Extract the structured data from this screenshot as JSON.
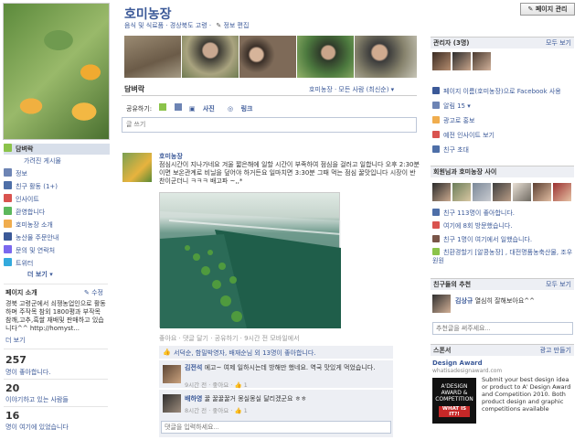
{
  "page": {
    "title": "호미농장",
    "category": "음식 및 식료품 · 경상북도 고령 ·",
    "edit_info": "정보 편집",
    "admin_button": "페이지 관리"
  },
  "nav": {
    "items": [
      {
        "label": "담벼락",
        "icon": "wall-icon",
        "color": "#8bc34a"
      },
      {
        "label": "가려진 게시물",
        "icon": "",
        "color": ""
      },
      {
        "label": "정보",
        "icon": "info-icon",
        "color": "#6d84b4"
      },
      {
        "label": "친구 활동 (1+)",
        "icon": "friends-icon",
        "color": "#4e6fa8"
      },
      {
        "label": "인사이트",
        "icon": "insights-icon",
        "color": "#d9534f"
      },
      {
        "label": "환영합니다",
        "icon": "welcome-icon",
        "color": "#5cb85c"
      },
      {
        "label": "호미농장 소개",
        "icon": "intro-icon",
        "color": "#f0ad4e"
      },
      {
        "label": "농산물 주문안내",
        "icon": "order-icon",
        "color": "#3b5998"
      },
      {
        "label": "문의 및 연락처",
        "icon": "contact-icon",
        "color": "#7b68ee"
      },
      {
        "label": "트위터",
        "icon": "twitter-icon",
        "color": "#33aadd"
      },
      {
        "label": "더 보기 ▾",
        "icon": "",
        "color": ""
      }
    ]
  },
  "about": {
    "heading": "페이지 소개",
    "edit": "✎ 수정",
    "text": "경북 고령군에서 쇠쟁농업인으로 활동하며 주작목 참외 1800평과 부작목 참깨,고추,흑쌀 재배및 판매하고 있습니다^^ http://homyst...",
    "more": "더 보기"
  },
  "stats": [
    {
      "num": "257",
      "label": "명이 좋아합니다."
    },
    {
      "num": "20",
      "label": "이야기하고 있는 사람들"
    },
    {
      "num": "16",
      "label": "명이 여기에 있었습니다"
    }
  ],
  "wall": {
    "tab": "담벼락",
    "filter": "호미농장 · 모든 사람 (최신순) ▾",
    "share_label": "공유하기:",
    "share_status": "",
    "share_photo": "사진",
    "share_link": "링크",
    "input_placeholder": "글 쓰기"
  },
  "post": {
    "author": "호미농장",
    "text": "점심시간이 지나가네요 겨울 짧은해에 일할 시간이 부족하여 점심을 걸러고 일합니다 오후 2:30분이면 보온관계로 비닐을 덮어야 하거든요 일마치면 3:30분 그때 먹는 점심 꿀맛입니다 시장이 반찬이군더니 ㅋㅋㅋ 배고파 ~,,*",
    "meta": "좋아요 · 댓글 달기 · 공유하기 · 9시간 전 모바일에서",
    "likes": "서덕순, 함밀박영자, 배재순님 외 13명이 좋아합니다."
  },
  "comments": [
    {
      "name": "김전석",
      "text": "에고~ 여제 일하시는데 방해만 했네요. 역국 맛있게 먹었습니다.",
      "meta": "9시간 전 · 좋아요 · 👍 1"
    },
    {
      "name": "배하영",
      "text": "꿀 꿀꿀꿀거 몽실몽실 달리겠군요 ㅎㅎ",
      "meta": "8시간 전 · 좋아요 · 👍 1"
    }
  ],
  "comment_placeholder": "댓글을 입력하세요...",
  "right": {
    "admins_heading": "관리자 (3명)",
    "admins_more": "모두 보기",
    "links": [
      {
        "label": "페이지 이름(호미농장)으로 Facebook 사용",
        "icon": "use-as-page-icon",
        "color": "#3b5998"
      },
      {
        "label": "알림 15 ▾",
        "icon": "notifications-icon",
        "color": "#6d84b4"
      },
      {
        "label": "광고로 홍보",
        "icon": "promote-icon",
        "color": "#f0ad4e"
      },
      {
        "label": "예전 인사이트 보기",
        "icon": "old-insights-icon",
        "color": "#d9534f"
      },
      {
        "label": "친구 초대",
        "icon": "invite-icon",
        "color": "#4e6fa8"
      }
    ],
    "mutual_heading": "회원님과 호미농장 사이",
    "mutual": [
      {
        "label": "친구 113명이 좋아합니다.",
        "icon": "likes-icon",
        "color": "#4e6fa8"
      },
      {
        "label": "여기에 8회 방문했습니다.",
        "icon": "checkin-icon",
        "color": "#d9534f"
      },
      {
        "label": "친구 1명이 여기에서 일했습니다.",
        "icon": "work-icon",
        "color": "#795548"
      },
      {
        "label": "친환경할기 [알콩농장] , 대전명품농축산물, 조우 원원",
        "icon": "similar-icon",
        "color": "#8bc34a"
      }
    ],
    "suggest_heading": "친구들의 추천",
    "suggest_more": "모두 보기",
    "suggest_name": "김상규",
    "suggest_text": "열심히 잘해보아요^^",
    "suggest_input": "추천글을 써주세요...",
    "sponsor_heading": "스폰서",
    "sponsor_more": "광고 만들기",
    "ad_title": "Design Award",
    "ad_domain": "whatisadesignaward.com",
    "ad_image_text": "A'DESIGN AWARD & COMPETITION",
    "ad_badge": "WHAT IS IT?!",
    "ad_text": "Submit your best design idea or product to A' Design Award and Competition 2010. Both product design and graphic competitions available"
  }
}
